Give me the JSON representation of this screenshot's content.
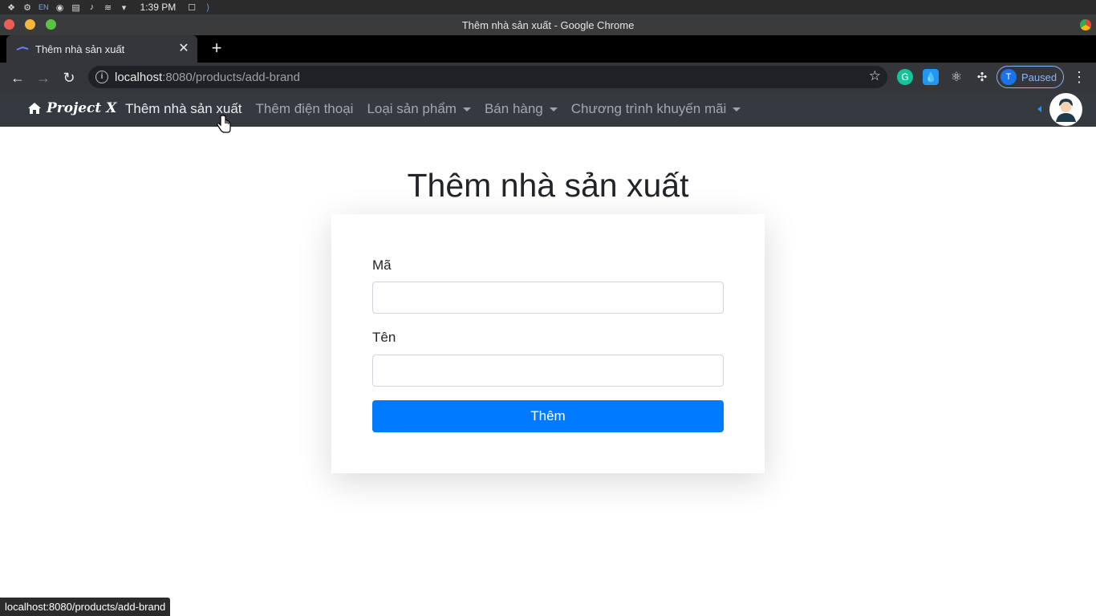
{
  "system": {
    "clock": "1:39 PM",
    "language": "EN"
  },
  "window": {
    "title": "Thêm nhà sản xuất - Google Chrome"
  },
  "tab": {
    "title": "Thêm nhà sản xuất",
    "close_glyph": "✕",
    "new_tab_glyph": "+"
  },
  "toolbar": {
    "url_host": "localhost",
    "url_path": ":8080/products/add-brand",
    "profile_initial": "T",
    "profile_status": "Paused"
  },
  "app": {
    "brand": "Project X",
    "nav": [
      {
        "label": "Thêm nhà sản xuất",
        "dropdown": false
      },
      {
        "label": "Thêm điện thoại",
        "dropdown": false
      },
      {
        "label": "Loại sản phẩm",
        "dropdown": true
      },
      {
        "label": "Bán hàng",
        "dropdown": true
      },
      {
        "label": "Chương trình khuyến mãi",
        "dropdown": true
      }
    ]
  },
  "form": {
    "title": "Thêm nhà sản xuất",
    "code_label": "Mã",
    "code_value": "",
    "name_label": "Tên",
    "name_value": "",
    "submit_label": "Thêm"
  },
  "status_url": "localhost:8080/products/add-brand",
  "colors": {
    "navbar_bg": "#343a40",
    "primary": "#007bff",
    "chrome_toolbar": "#35363a"
  }
}
